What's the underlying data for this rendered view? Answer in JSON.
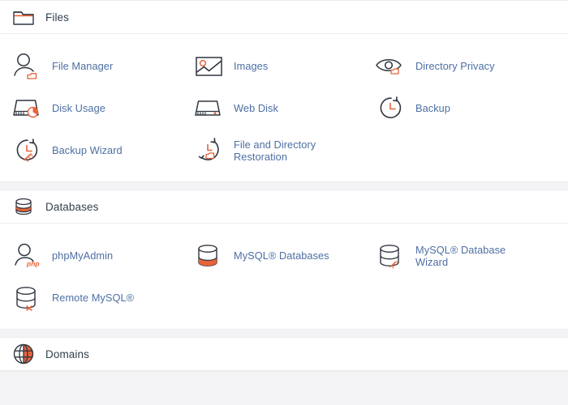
{
  "colors": {
    "accent_orange": "#e8633a",
    "link_blue": "#4d6fa3",
    "header_text": "#33404f",
    "icon_stroke": "#2f3640",
    "page_background": "#f4f4f6",
    "card_background": "#ffffff"
  },
  "sections": [
    {
      "id": "files",
      "title": "Files",
      "header_icon": "folder-icon",
      "items": [
        {
          "label": "File Manager",
          "icon": "file-manager-icon"
        },
        {
          "label": "Images",
          "icon": "images-icon"
        },
        {
          "label": "Directory Privacy",
          "icon": "directory-privacy-icon"
        },
        {
          "label": "Disk Usage",
          "icon": "disk-usage-icon"
        },
        {
          "label": "Web Disk",
          "icon": "web-disk-icon"
        },
        {
          "label": "Backup",
          "icon": "backup-icon"
        },
        {
          "label": "Backup Wizard",
          "icon": "backup-wizard-icon"
        },
        {
          "label": "File and Directory Restoration",
          "icon": "file-restoration-icon"
        }
      ]
    },
    {
      "id": "databases",
      "title": "Databases",
      "header_icon": "database-icon",
      "items": [
        {
          "label": "phpMyAdmin",
          "icon": "phpmyadmin-icon"
        },
        {
          "label": "MySQL® Databases",
          "icon": "mysql-databases-icon"
        },
        {
          "label": "MySQL® Database Wizard",
          "icon": "mysql-wizard-icon"
        },
        {
          "label": "Remote MySQL®",
          "icon": "remote-mysql-icon"
        }
      ]
    },
    {
      "id": "domains",
      "title": "Domains",
      "header_icon": "globe-icon",
      "items": []
    }
  ]
}
